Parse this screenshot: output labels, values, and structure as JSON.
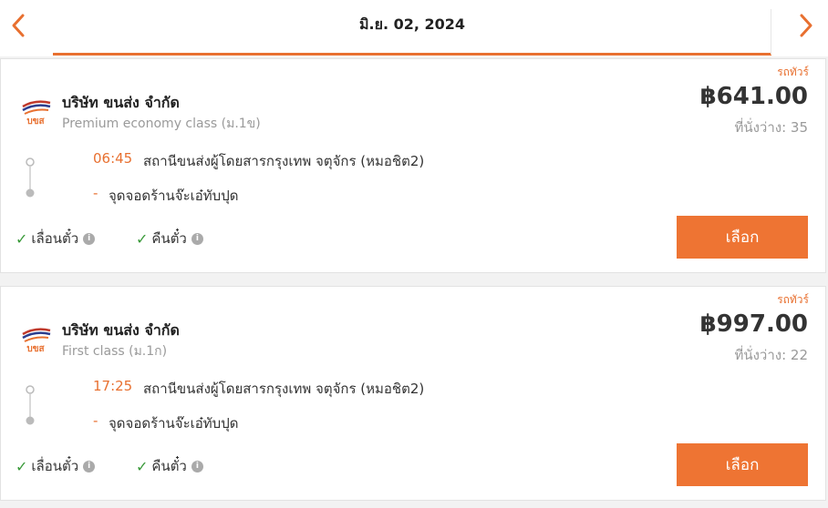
{
  "header": {
    "date": "มิ.ย. 02, 2024",
    "prev_icon": "chevron-left-icon",
    "next_icon": "chevron-right-icon",
    "accent_color": "#e87030"
  },
  "trips": [
    {
      "tag": "รถทัวร์",
      "company": "บริษัท ขนส่ง จำกัด",
      "class_name": "Premium economy class (ม.1ข)",
      "price": "฿641.00",
      "seats": "ที่นั่งว่าง: 35",
      "departure_time": "06:45",
      "departure_station": "สถานีขนส่งผู้โดยสารกรุงเทพ จตุจักร (หมอชิต2)",
      "arrival_dash": "-",
      "arrival_station": "จุดจอดร้านจ๊ะเอ๋ทับปุด",
      "policy_change": "เลื่อนตั๋ว",
      "policy_refund": "คืนตั๋ว",
      "select_label": "เลือก",
      "logo_text": "บขส"
    },
    {
      "tag": "รถทัวร์",
      "company": "บริษัท ขนส่ง จำกัด",
      "class_name": "First class (ม.1ก)",
      "price": "฿997.00",
      "seats": "ที่นั่งว่าง: 22",
      "departure_time": "17:25",
      "departure_station": "สถานีขนส่งผู้โดยสารกรุงเทพ จตุจักร (หมอชิต2)",
      "arrival_dash": "-",
      "arrival_station": "จุดจอดร้านจ๊ะเอ๋ทับปุด",
      "policy_change": "เลื่อนตั๋ว",
      "policy_refund": "คืนตั๋ว",
      "select_label": "เลือก",
      "logo_text": "บขส"
    }
  ]
}
